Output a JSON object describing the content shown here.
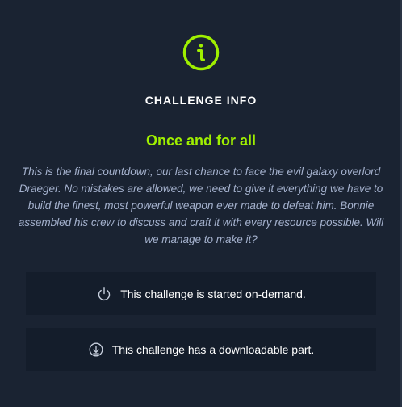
{
  "heading": "CHALLENGE INFO",
  "challenge": {
    "name": "Once and for all",
    "description": "This is the final countdown, our last chance to face the evil galaxy overlord Draeger. No mistakes are allowed, we need to give it everything we have to build the finest, most powerful weapon ever made to defeat him. Bonnie assembled his crew to discuss and craft it with every resource possible. Will we manage to make it?"
  },
  "features": [
    {
      "icon": "power-icon",
      "text": "This challenge is started on-demand."
    },
    {
      "icon": "download-icon",
      "text": "This challenge has a downloadable part."
    }
  ],
  "colors": {
    "accent": "#9fef00",
    "background": "#1a2332",
    "card": "#141d2b",
    "description": "#a4b1cd"
  }
}
